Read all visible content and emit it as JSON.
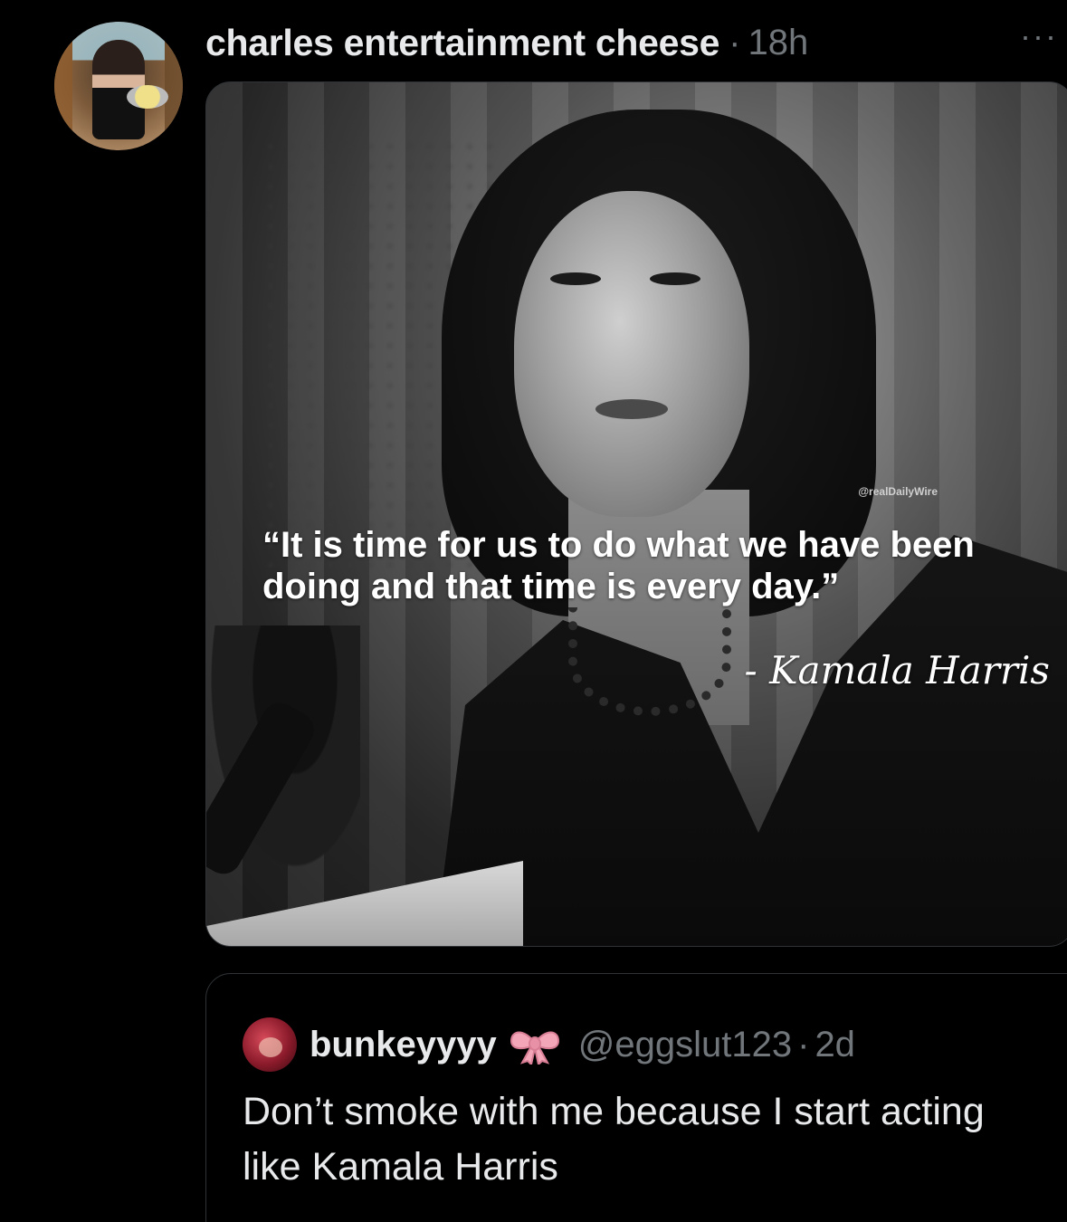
{
  "post": {
    "display_name": "charles entertainment cheese",
    "separator": "·",
    "time": "18h",
    "more_label": "···",
    "media": {
      "watermark": "@realDailyWire",
      "quote_text": "“It is time for us to do what we have been doing and that time is every day.”",
      "attribution": "- Kamala Harris"
    }
  },
  "quoted_post": {
    "display_name": "bunkeyyyy",
    "handle": "@eggslut123",
    "separator": "·",
    "time": "2d",
    "text": "Don’t smoke with me because I start acting like Kamala Harris"
  },
  "colors": {
    "background": "#000000",
    "primary_text": "#e7e9ea",
    "secondary_text": "#71767b",
    "border": "#2f3336",
    "bow_pink": "#f3a6b8"
  },
  "icons": {
    "more": "more-horizontal-icon",
    "bow": "ribbon-bow-icon"
  }
}
